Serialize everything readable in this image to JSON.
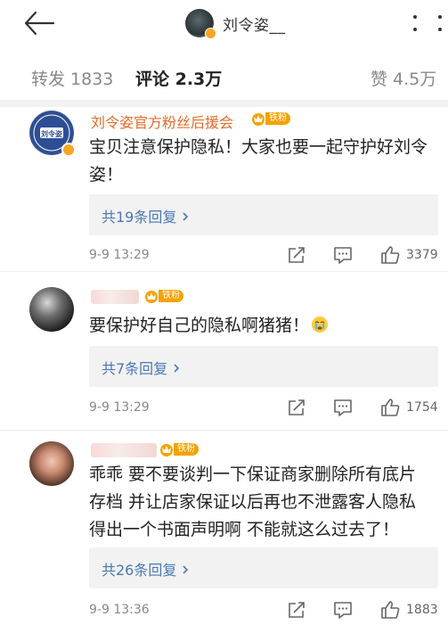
{
  "header": {
    "title": "刘令姿__",
    "back_icon": "arrow-left-icon",
    "more_icon": "more-vertical-icon"
  },
  "tabs": {
    "repost": "转发 1833",
    "comments": "评论 2.3万",
    "likes": "赞 4.5万"
  },
  "comments": [
    {
      "name": "刘令姿官方粉丝后援会",
      "avatar_text": "刘令姿",
      "fan_badge": "铁粉",
      "text": "宝贝注意保护隐私！大家也要一起守护好刘令姿！",
      "replies": "共19条回复 ",
      "time": "9-9 13:29",
      "likes": "3379"
    },
    {
      "name": "",
      "fan_badge": "铁粉",
      "text": "要保护好自己的隐私啊猪猪！",
      "replies": "共7条回复 ",
      "time": "9-9 13:29",
      "likes": "1754"
    },
    {
      "name": "",
      "fan_badge": "铁粉",
      "text": "乖乖 要不要谈判一下保证商家删除所有底片存档 并让店家保证以后再也不泄露客人隐私 得出一个书面声明啊 不能就这么过去了！",
      "replies": "共26条回复 ",
      "time": "9-9 13:36",
      "likes": "1883"
    }
  ],
  "colors": {
    "name_orange": "#e36c2a",
    "reply_blue": "#4a78b5",
    "badge_orange": "#f5a200"
  }
}
